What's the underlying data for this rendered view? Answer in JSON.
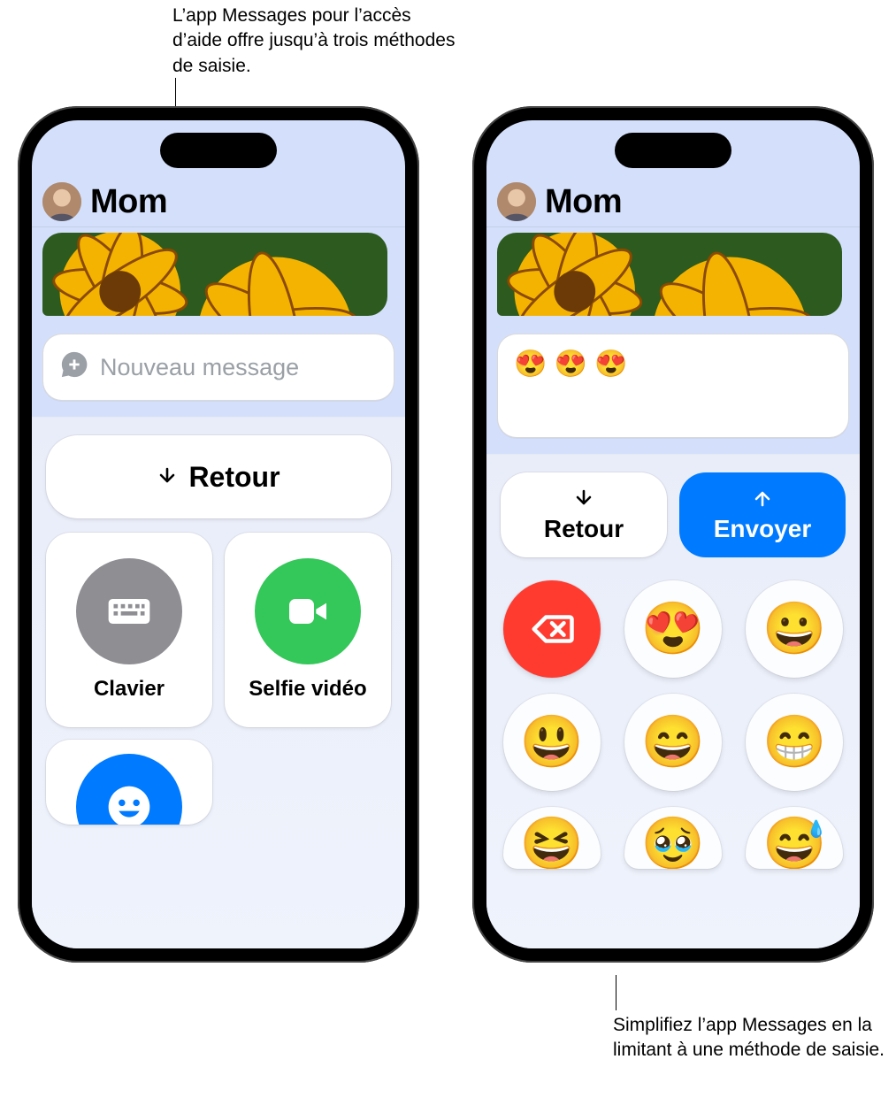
{
  "callouts": {
    "top": "L’app Messages pour l’accès d’aide offre jusqu’à trois méthodes de saisie.",
    "bottom": "Simplifiez l’app Messages en la limitant à une méthode de saisie."
  },
  "left": {
    "contact": "Mom",
    "compose_placeholder": "Nouveau message",
    "back_label": "Retour",
    "tiles": {
      "keyboard": "Clavier",
      "video": "Selfie vidéo"
    }
  },
  "right": {
    "contact": "Mom",
    "compose_value": "😍 😍 😍",
    "back_label": "Retour",
    "send_label": "Envoyer",
    "emoji_keys": [
      "😍",
      "😀",
      "😃",
      "😄",
      "😁",
      "😆",
      "🥹",
      "😅"
    ]
  }
}
